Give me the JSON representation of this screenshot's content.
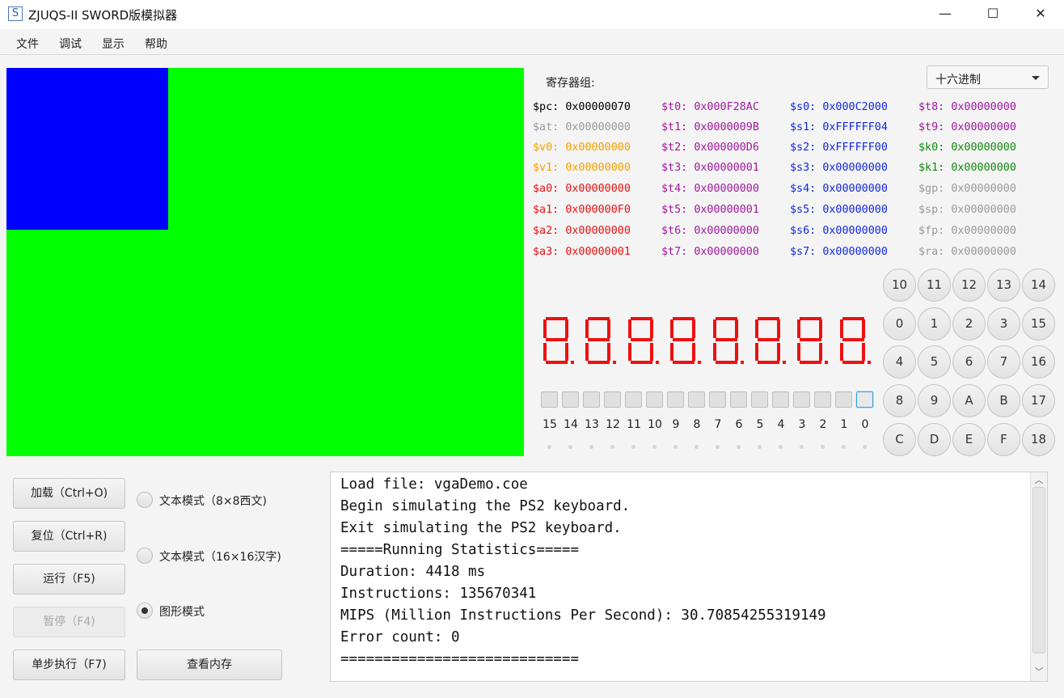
{
  "window": {
    "title": "ZJUQS-II SWORD版模拟器",
    "icon": "S",
    "minimize": "—",
    "maximize": "☐",
    "close": "✕"
  },
  "menu": [
    "文件",
    "调试",
    "显示",
    "帮助"
  ],
  "vga": {
    "background_color": "#00ff00",
    "block_color": "#0000ff"
  },
  "registers": {
    "title": "寄存器组:",
    "base_select": "十六进制",
    "columns": [
      [
        {
          "name": "$pc:",
          "value": "0x00000070",
          "color": "#000000"
        },
        {
          "name": "$at:",
          "value": "0x00000000",
          "color": "#9a9a9a"
        },
        {
          "name": "$v0:",
          "value": "0x00000000",
          "color": "#f5a000"
        },
        {
          "name": "$v1:",
          "value": "0x00000000",
          "color": "#f5a000"
        },
        {
          "name": "$a0:",
          "value": "0x00000000",
          "color": "#e81010"
        },
        {
          "name": "$a1:",
          "value": "0x000000F0",
          "color": "#e81010"
        },
        {
          "name": "$a2:",
          "value": "0x00000000",
          "color": "#e81010"
        },
        {
          "name": "$a3:",
          "value": "0x00000001",
          "color": "#e81010"
        }
      ],
      [
        {
          "name": "$t0:",
          "value": "0x000F28AC",
          "color": "#a0189e"
        },
        {
          "name": "$t1:",
          "value": "0x0000009B",
          "color": "#a0189e"
        },
        {
          "name": "$t2:",
          "value": "0x000000D6",
          "color": "#a0189e"
        },
        {
          "name": "$t3:",
          "value": "0x00000001",
          "color": "#a0189e"
        },
        {
          "name": "$t4:",
          "value": "0x00000000",
          "color": "#a0189e"
        },
        {
          "name": "$t5:",
          "value": "0x00000001",
          "color": "#a0189e"
        },
        {
          "name": "$t6:",
          "value": "0x00000000",
          "color": "#a0189e"
        },
        {
          "name": "$t7:",
          "value": "0x00000000",
          "color": "#a0189e"
        }
      ],
      [
        {
          "name": "$s0:",
          "value": "0x000C2000",
          "color": "#1028e8"
        },
        {
          "name": "$s1:",
          "value": "0xFFFFFF04",
          "color": "#1028e8"
        },
        {
          "name": "$s2:",
          "value": "0xFFFFFF00",
          "color": "#1028e8"
        },
        {
          "name": "$s3:",
          "value": "0x00000000",
          "color": "#1028e8"
        },
        {
          "name": "$s4:",
          "value": "0x00000000",
          "color": "#1028e8"
        },
        {
          "name": "$s5:",
          "value": "0x00000000",
          "color": "#1028e8"
        },
        {
          "name": "$s6:",
          "value": "0x00000000",
          "color": "#1028e8"
        },
        {
          "name": "$s7:",
          "value": "0x00000000",
          "color": "#1028e8"
        }
      ],
      [
        {
          "name": "$t8:",
          "value": "0x00000000",
          "color": "#a0189e"
        },
        {
          "name": "$t9:",
          "value": "0x00000000",
          "color": "#a0189e"
        },
        {
          "name": "$k0:",
          "value": "0x00000000",
          "color": "#118a11"
        },
        {
          "name": "$k1:",
          "value": "0x00000000",
          "color": "#118a11"
        },
        {
          "name": "$gp:",
          "value": "0x00000000",
          "color": "#9a9a9a"
        },
        {
          "name": "$sp:",
          "value": "0x00000000",
          "color": "#9a9a9a"
        },
        {
          "name": "$fp:",
          "value": "0x00000000",
          "color": "#9a9a9a"
        },
        {
          "name": "$ra:",
          "value": "0x00000000",
          "color": "#9a9a9a"
        }
      ]
    ]
  },
  "seven_segment": {
    "digits": [
      "8",
      "8",
      "8",
      "8",
      "8",
      "8",
      "8",
      "8"
    ],
    "color": "#ee1010"
  },
  "leds": {
    "labels": [
      "15",
      "14",
      "13",
      "12",
      "11",
      "10",
      "9",
      "8",
      "7",
      "6",
      "5",
      "4",
      "3",
      "2",
      "1",
      "0"
    ]
  },
  "keypad": [
    [
      "10",
      "11",
      "12",
      "13",
      "14"
    ],
    [
      "0",
      "1",
      "2",
      "3",
      "15"
    ],
    [
      "4",
      "5",
      "6",
      "7",
      "16"
    ],
    [
      "8",
      "9",
      "A",
      "B",
      "17"
    ],
    [
      "C",
      "D",
      "E",
      "F",
      "18"
    ]
  ],
  "controls": {
    "load": "加载（Ctrl+O)",
    "reset": "复位（Ctrl+R)",
    "run": "运行（F5)",
    "pause": "暂停（F4)",
    "step": "单步执行（F7)",
    "view_memory": "查看内存"
  },
  "display_modes": [
    {
      "label": "文本模式（8×8西文)",
      "selected": false
    },
    {
      "label": "文本模式（16×16汉字)",
      "selected": false
    },
    {
      "label": "图形模式",
      "selected": true
    }
  ],
  "console": {
    "lines": [
      "Load file: vgaDemo.coe",
      "Begin simulating the PS2 keyboard.",
      "Exit simulating the PS2 keyboard.",
      "=====Running Statistics=====",
      "Duration: 4418 ms",
      "Instructions: 135670341",
      "MIPS (Million Instructions Per Second): 30.70854255319149",
      "Error count: 0",
      "============================"
    ]
  }
}
